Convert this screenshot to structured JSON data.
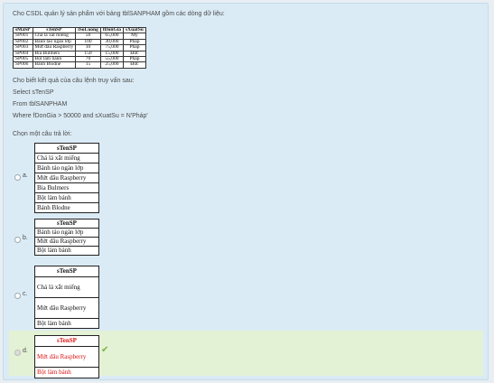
{
  "question": {
    "intro": "Cho CSDL quản lý sản phẩm với bảng tblSANPHAM gồm các dòng dữ liệu:",
    "table": {
      "headers": [
        "sMaSP",
        "sTenSP",
        "iSoLuong",
        "fDonGia",
        "sXuatSu"
      ],
      "rows": [
        [
          "SP001",
          "Chả lá xắt miếng",
          "50",
          "65,000",
          "Mỹ"
        ],
        [
          "SP002",
          "Bánh táo ngàn lớp",
          "100",
          "30,000",
          "Pháp"
        ],
        [
          "SP003",
          "Mứt dâu Raspberry",
          "10",
          "75,000",
          "Pháp"
        ],
        [
          "SP004",
          "Bia Bulmers",
          "150",
          "15,000",
          "Đức"
        ],
        [
          "SP005",
          "Bột làm bánh",
          "70",
          "55,000",
          "Pháp"
        ],
        [
          "SP006",
          "Bánh Blodne",
          "15",
          "25,000",
          "Đức"
        ]
      ]
    },
    "ask": "Cho biết kết quả của câu lệnh truy vấn sau:",
    "sql_select": "Select sTenSP",
    "sql_from": "From tblSANPHAM",
    "sql_where": "Where fDonGia > 50000 and sXuatSu = N'Pháp'",
    "choose": "Chọn một câu trả lời:"
  },
  "options": [
    {
      "letter": "a.",
      "header": "sTenSP",
      "rows": [
        "Chả lá xắt miếng",
        "Bánh táo ngàn lớp",
        "Mứt dâu Raspberry",
        "Bia Bulmers",
        "Bột làm bánh",
        "Bánh Blodne"
      ]
    },
    {
      "letter": "b.",
      "header": "sTenSP",
      "rows": [
        "Bánh táo ngàn lớp",
        "Mứt dâu Raspberry",
        "Bột làm bánh"
      ]
    },
    {
      "letter": "c.",
      "header": "sTenSP",
      "rows": [
        "Chả lá xắt miếng",
        "Mứt dâu Raspberry",
        "Bột làm bánh"
      ]
    },
    {
      "letter": "d.",
      "header": "sTenSP",
      "rows": [
        "Mứt dâu Raspberry",
        "Bột làm bánh"
      ],
      "selected": true,
      "correct": true
    }
  ]
}
